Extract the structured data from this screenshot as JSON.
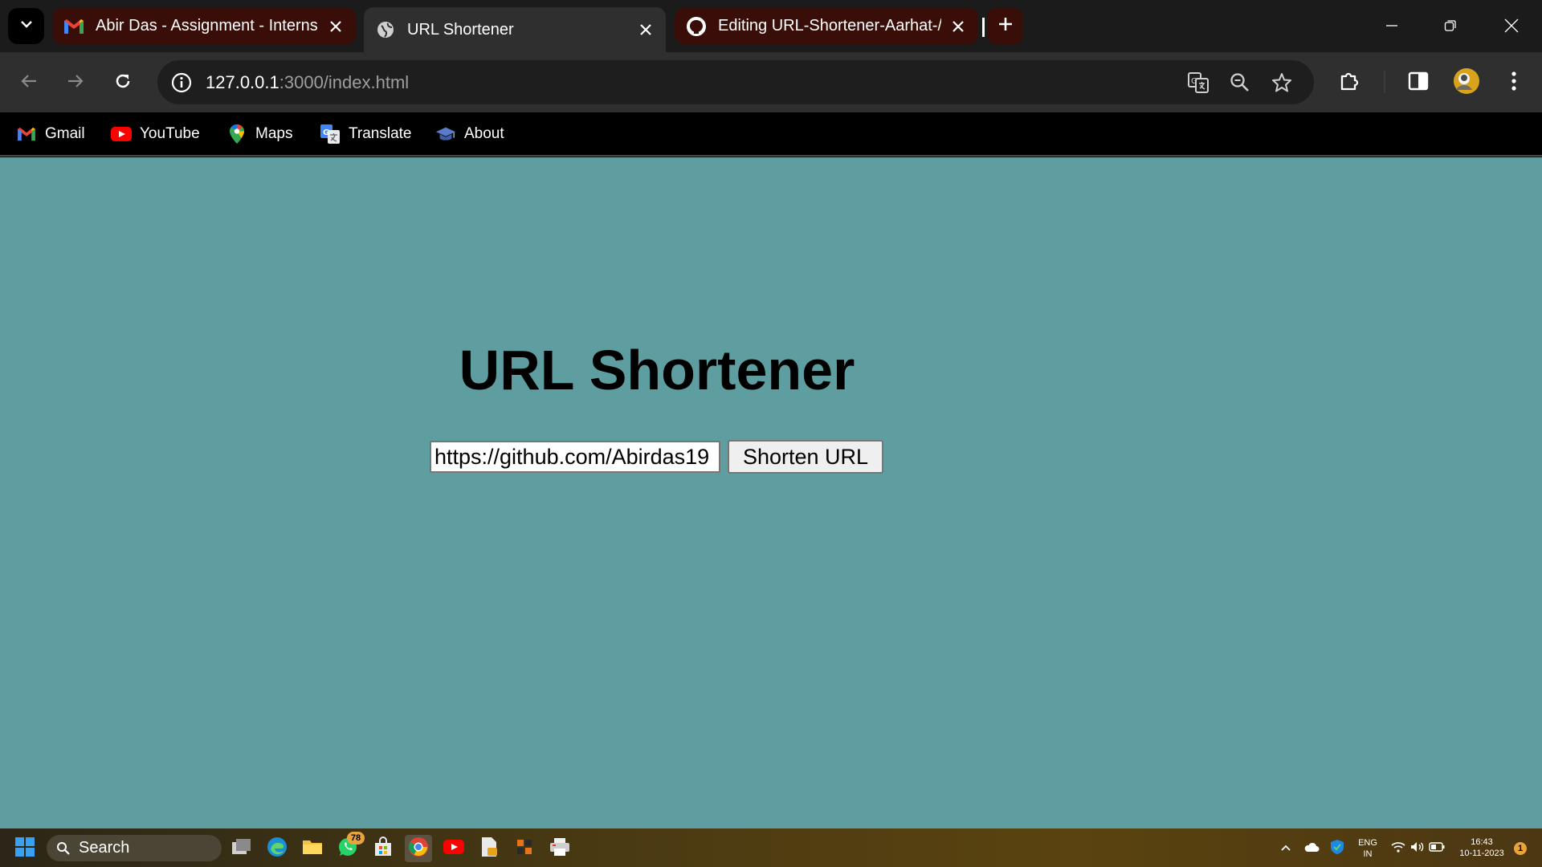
{
  "browser": {
    "tabs": [
      {
        "title": "Abir Das - Assignment - Interns",
        "icon": "gmail-icon",
        "active": false
      },
      {
        "title": "URL Shortener",
        "icon": "globe-icon",
        "active": true
      },
      {
        "title": "Editing URL-Shortener-Aarhat-/",
        "icon": "github-icon",
        "active": false
      }
    ],
    "address": {
      "host": "127.0.0.1",
      "rest": ":3000/index.html"
    },
    "bookmarks": [
      {
        "label": "Gmail",
        "icon": "gmail-icon"
      },
      {
        "label": "YouTube",
        "icon": "youtube-icon"
      },
      {
        "label": "Maps",
        "icon": "maps-icon"
      },
      {
        "label": "Translate",
        "icon": "translate-icon"
      },
      {
        "label": "About",
        "icon": "graduation-cap-icon"
      }
    ]
  },
  "page": {
    "title": "URL Shortener",
    "input_value": "https://github.com/Abirdas19",
    "button_label": "Shorten URL",
    "background": "#5f9ea0"
  },
  "taskbar": {
    "search_label": "Search",
    "whatsapp_badge": "78",
    "lang_top": "ENG",
    "lang_bottom": "IN",
    "time": "16:43",
    "date": "10-11-2023",
    "notification_count": "1"
  },
  "colors": {
    "tab_strip": "#1b1b1b",
    "toolbar": "#2f2f2f",
    "inactive_tab": "#3a0e08",
    "accent": "#5f9ea0"
  }
}
